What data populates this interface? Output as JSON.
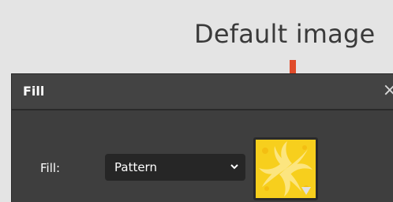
{
  "annotation": {
    "text": "Default image"
  },
  "dialog": {
    "title": "Fill",
    "close_glyph": "×",
    "fill_label": "Fill:",
    "fill_select_value": "Pattern",
    "pattern_preview": "yellow-swirl-pattern"
  },
  "colors": {
    "arrow": "#e04b2a",
    "dialog_bg": "#3e3e3e",
    "select_bg": "#262626",
    "pattern_yellow": "#f7cf1d",
    "pattern_light": "#fde88a"
  },
  "icons": {
    "close": "close-icon",
    "dropdown": "chevron-down-icon",
    "arrow": "arrow-down-icon"
  }
}
